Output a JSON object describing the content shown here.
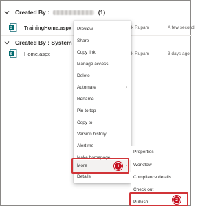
{
  "groups": [
    {
      "prefix": "Created By : ",
      "suffix": " (1)",
      "files": [
        {
          "name": "TrainingHome.aspx",
          "modified_by": "k Rupam",
          "modified": "A few second"
        }
      ]
    },
    {
      "prefix": "Created By : System Accou",
      "suffix": "",
      "files": [
        {
          "name": "Home.aspx",
          "modified_by": "k Rupam",
          "modified": "3 days ago"
        }
      ]
    }
  ],
  "context_menu": {
    "items": [
      "Preview",
      "Share",
      "Copy link",
      "Manage access",
      "Delete",
      "Automate",
      "Rename",
      "Pin to top",
      "Copy to",
      "Version history",
      "Alert me",
      "Make homepage",
      "More",
      "Details"
    ],
    "submenu_arrow": "›"
  },
  "submenu": {
    "items": [
      "Properties",
      "Workflow",
      "Compliance details",
      "Check out",
      "Publish"
    ]
  },
  "callouts": {
    "more_badge": "1",
    "publish_badge": "2"
  },
  "colors": {
    "callout_red": "#d13438",
    "badge_red": "#c50f1f"
  }
}
